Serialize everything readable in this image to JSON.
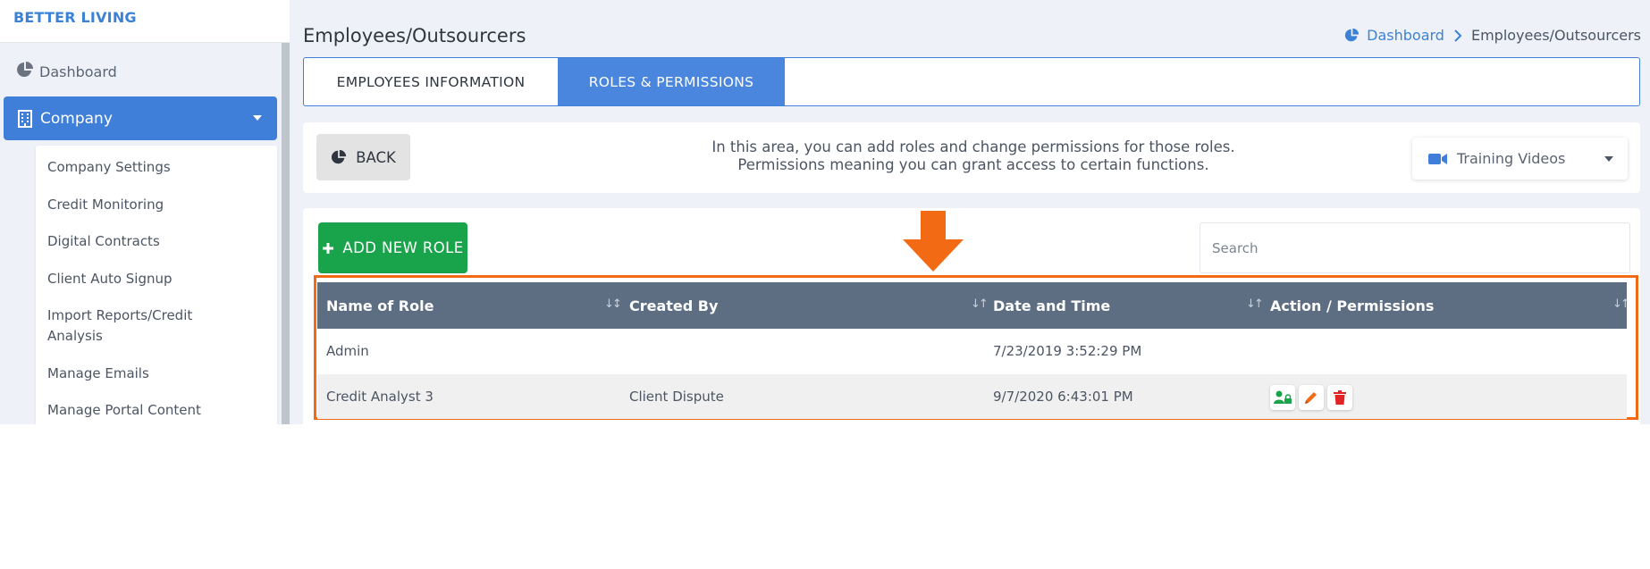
{
  "app": {
    "brand": "BETTER LIVING"
  },
  "sidebar": {
    "dashboard_label": "Dashboard",
    "company_label": "Company",
    "submenu": [
      "Company Settings",
      "Credit Monitoring",
      "Digital Contracts",
      "Client Auto Signup",
      "Import Reports/Credit Analysis",
      "Manage Emails",
      "Manage Portal Content"
    ]
  },
  "header": {
    "title": "Employees/Outsourcers",
    "breadcrumb": {
      "link": "Dashboard",
      "current": "Employees/Outsourcers"
    }
  },
  "tabs": [
    {
      "label": "EMPLOYEES INFORMATION",
      "active": false
    },
    {
      "label": "ROLES & PERMISSIONS",
      "active": true
    }
  ],
  "info": {
    "back_label": "BACK",
    "line1": "In this area, you can add roles and change permissions for those roles.",
    "line2": "Permissions meaning you can grant access to certain functions.",
    "training_label": "Training Videos"
  },
  "toolbar": {
    "add_role_label": "ADD NEW ROLE",
    "search_placeholder": "Search"
  },
  "table": {
    "columns": [
      "Name of Role",
      "Created By",
      "Date and Time",
      "Action / Permissions"
    ],
    "rows": [
      {
        "name": "Admin",
        "created_by": "",
        "datetime": "7/23/2019 3:52:29 PM",
        "has_actions": false
      },
      {
        "name": "Credit Analyst 3",
        "created_by": "Client Dispute",
        "datetime": "9/7/2020 6:43:01 PM",
        "has_actions": true
      }
    ]
  },
  "colors": {
    "accent": "#3f7fd9",
    "success": "#19a34a",
    "header_bg": "#5d6e83",
    "highlight": "#f26a14",
    "danger": "#e02424",
    "edit": "#f26a14"
  }
}
